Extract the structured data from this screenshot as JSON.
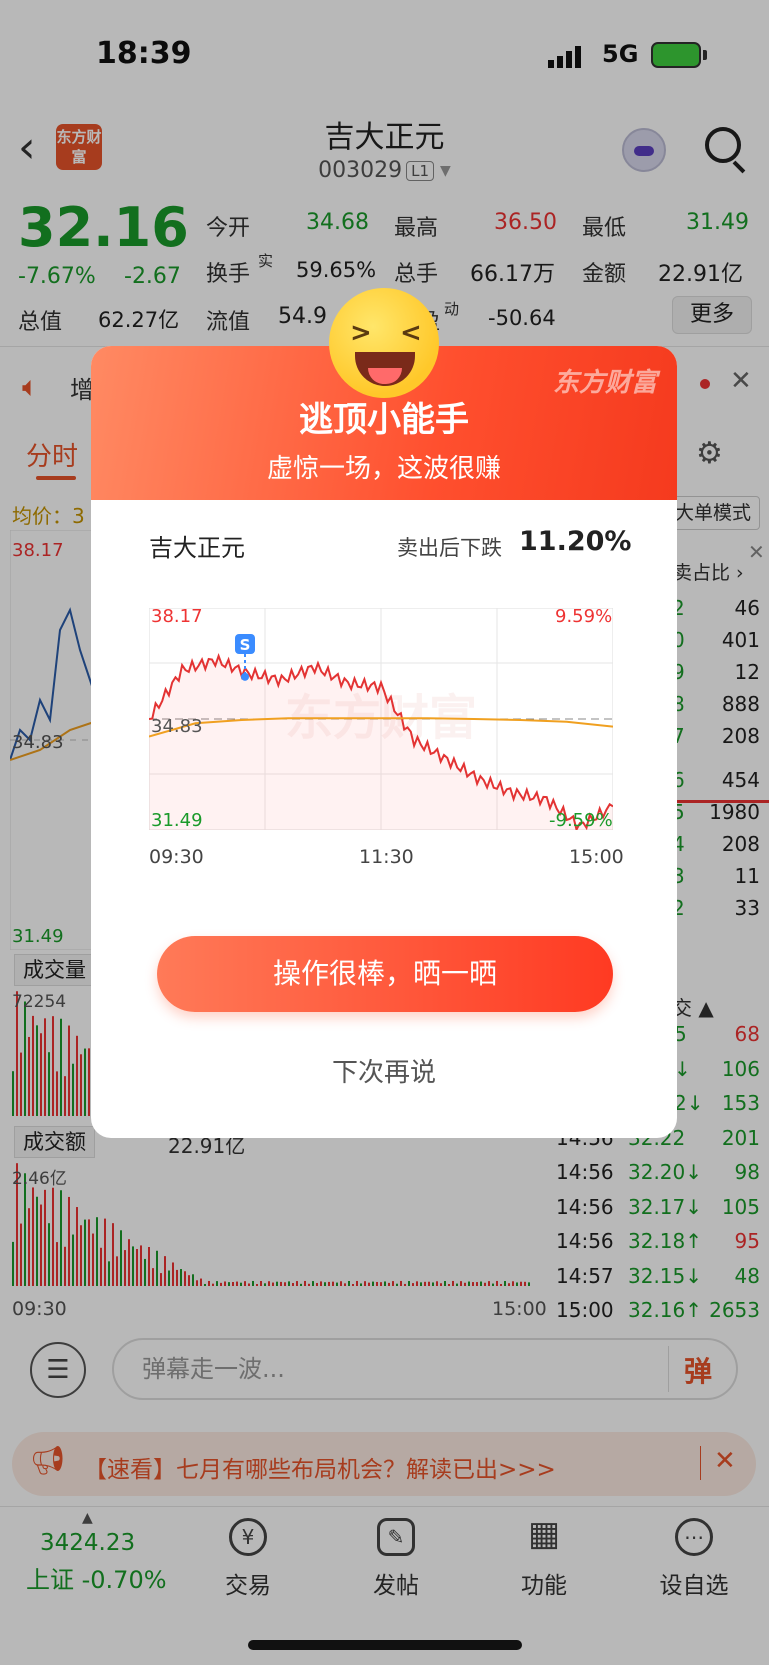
{
  "status_bar": {
    "time": "18:39",
    "network": "5G"
  },
  "header": {
    "back_icon": "back-chevron-icon",
    "logo_text": "东方财富",
    "stock_name": "吉大正元",
    "stock_code": "003029",
    "level_badge": "L1"
  },
  "quote": {
    "price": "32.16",
    "pct_change": "-7.67%",
    "change": "-2.67",
    "rows": [
      [
        {
          "label": "今开",
          "value": "34.68",
          "color": "green"
        },
        {
          "label": "最高",
          "value": "36.50",
          "color": "red"
        },
        {
          "label": "最低",
          "value": "31.49",
          "color": "green"
        }
      ],
      [
        {
          "label": "换手",
          "value": "59.65%",
          "color": "black"
        },
        {
          "label": "总手",
          "value": "66.17万",
          "color": "black"
        },
        {
          "label": "金额",
          "value": "22.91亿",
          "color": "black"
        }
      ],
      [
        {
          "label": "总值",
          "value": "62.27亿",
          "color": "black"
        },
        {
          "label": "流值",
          "value": "54.9",
          "color": "black"
        },
        {
          "label": "盈",
          "value": "-50.64",
          "color": "black"
        }
      ]
    ],
    "more_button": "更多",
    "turnover_sup": "实",
    "pe_sup": "动"
  },
  "ticker": {
    "text": "增"
  },
  "tabs": {
    "active": "分时"
  },
  "chart_area": {
    "avg_label": "均价：3",
    "mode_button": "大单模式",
    "price_high": "38.17",
    "price_low": "31.49",
    "price_mid": "34.83",
    "volume_label": "成交量",
    "volume_max": "72254",
    "amount_label": "成交额",
    "amount_total": "22.91亿",
    "amount_max": "2.46亿",
    "time_start": "09:30",
    "time_end": "15:00",
    "ratio_label": "卖占比 ›"
  },
  "order_book": [
    {
      "price": "2",
      "vol": "46",
      "color": "green"
    },
    {
      "price": "0",
      "vol": "401",
      "color": "green"
    },
    {
      "price": "9",
      "vol": "12",
      "color": "green"
    },
    {
      "price": "8",
      "vol": "888",
      "color": "green"
    },
    {
      "price": "7",
      "vol": "208",
      "color": "green"
    },
    {
      "price": "6",
      "vol": "454",
      "color": "green"
    },
    {
      "price": "5",
      "vol": "1980",
      "color": "green"
    },
    {
      "price": "4",
      "vol": "208",
      "color": "green"
    },
    {
      "price": "3",
      "vol": "11",
      "color": "green"
    },
    {
      "price": "2",
      "vol": "33",
      "color": "green"
    }
  ],
  "trades_header": "交 ▲",
  "trades": [
    {
      "time": "",
      "price": "5",
      "vol": "68",
      "color": "green",
      "vcolor": "red"
    },
    {
      "time": "",
      "price": "↓",
      "vol": "106",
      "color": "green",
      "vcolor": "green"
    },
    {
      "time": "",
      "price": "2↓",
      "vol": "153",
      "color": "green",
      "vcolor": "green"
    },
    {
      "time": "14:56",
      "price": "32.22",
      "vol": "201",
      "color": "green",
      "vcolor": "green"
    },
    {
      "time": "14:56",
      "price": "32.20↓",
      "vol": "98",
      "color": "green",
      "vcolor": "green"
    },
    {
      "time": "14:56",
      "price": "32.17↓",
      "vol": "105",
      "color": "green",
      "vcolor": "green"
    },
    {
      "time": "14:56",
      "price": "32.18↑",
      "vol": "95",
      "color": "green",
      "vcolor": "red"
    },
    {
      "time": "14:57",
      "price": "32.15↓",
      "vol": "48",
      "color": "green",
      "vcolor": "green"
    },
    {
      "time": "15:00",
      "price": "32.16↑",
      "vol": "2653",
      "color": "green",
      "vcolor": "green"
    }
  ],
  "danmu": {
    "placeholder": "弹幕走一波...",
    "send": "弹"
  },
  "promo": {
    "text": "【速看】七月有哪些布局机会？解读已出>>>"
  },
  "nav": {
    "index_value": "3424.23",
    "index_label": "上证 -0.70%",
    "items": [
      {
        "label": "交易",
        "icon": "yen-icon",
        "glyph": "¥"
      },
      {
        "label": "发帖",
        "icon": "edit-icon",
        "glyph": "✎"
      },
      {
        "label": "功能",
        "icon": "grid-icon",
        "glyph": "▦"
      },
      {
        "label": "设自选",
        "icon": "more-icon",
        "glyph": "⋯"
      }
    ]
  },
  "modal": {
    "brand": "东方财富",
    "title": "逃顶小能手",
    "subtitle": "虚惊一场，这波很赚",
    "stock_name": "吉大正元",
    "drop_label": "卖出后下跌",
    "drop_value": "11.20%",
    "chart": {
      "high": "38.17",
      "high_pct": "9.59%",
      "mid": "34.83",
      "low": "31.49",
      "low_pct": "-9.59%",
      "t1": "09:30",
      "t2": "11:30",
      "t3": "15:00",
      "sell_marker": "S"
    },
    "share_button": "操作很棒，晒一晒",
    "later_button": "下次再说"
  },
  "chart_data": {
    "type": "line",
    "title": "",
    "x": [
      "09:30",
      "11:30",
      "15:00"
    ],
    "ylim": [
      31.49,
      38.17
    ],
    "series": [
      {
        "values": [
          34.83,
          36.3,
          36.6,
          36.2,
          36.0,
          36.4,
          35.9,
          35.8,
          34.2,
          33.6,
          33.0,
          32.6,
          32.4,
          31.6,
          32.2
        ]
      },
      {
        "values": [
          34.3,
          34.7,
          34.8,
          34.85,
          34.85,
          34.85,
          34.85,
          34.83,
          34.8,
          34.75,
          34.6
        ]
      }
    ],
    "sell_point": {
      "x": "10:15",
      "y": 36.4,
      "label": "S"
    },
    "accent": "#e33333",
    "avg_color": "#f0a020"
  }
}
